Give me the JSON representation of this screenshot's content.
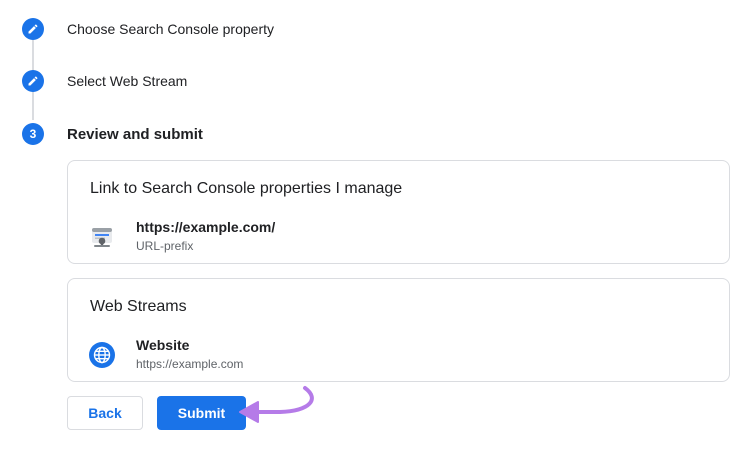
{
  "steps": [
    {
      "label": "Choose Search Console property",
      "icon": "pencil-icon"
    },
    {
      "label": "Select Web Stream",
      "icon": "pencil-icon"
    },
    {
      "number": "3",
      "label": "Review and submit"
    }
  ],
  "search_console_card": {
    "title": "Link to Search Console properties I manage",
    "item": {
      "primary": "https://example.com/",
      "secondary": "URL-prefix",
      "icon": "search-console-icon"
    }
  },
  "web_streams_card": {
    "title": "Web Streams",
    "item": {
      "primary": "Website",
      "secondary": "https://example.com",
      "icon": "globe-icon"
    }
  },
  "buttons": {
    "back": "Back",
    "submit": "Submit"
  },
  "colors": {
    "accent": "#1a73e8",
    "annotation_arrow": "#b57be8"
  }
}
